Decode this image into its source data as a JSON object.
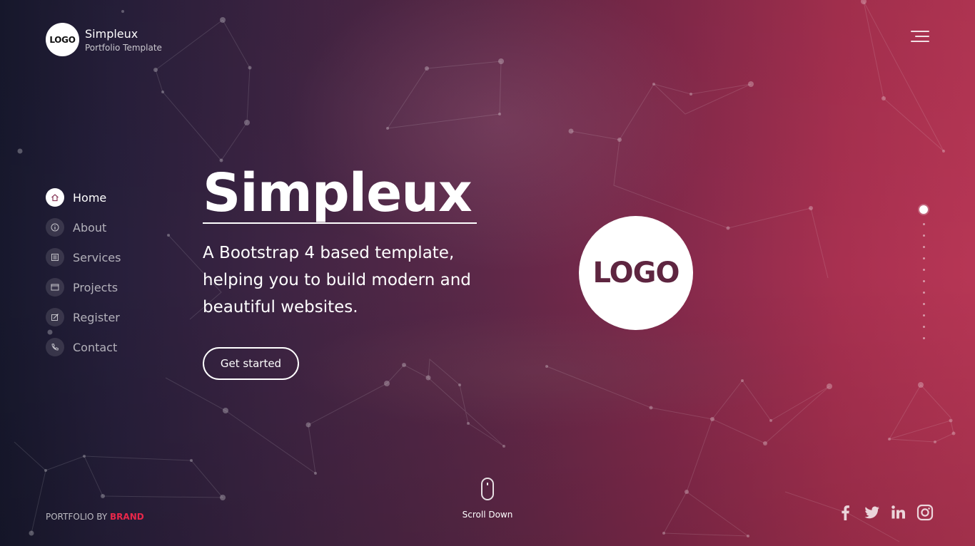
{
  "header": {
    "logo_text": "LOGO",
    "brand_name": "Simpleux",
    "brand_tagline": "Portfolio Template"
  },
  "nav": {
    "items": [
      {
        "label": "Home",
        "icon": "home-icon",
        "active": true
      },
      {
        "label": "About",
        "icon": "info-icon",
        "active": false
      },
      {
        "label": "Services",
        "icon": "list-icon",
        "active": false
      },
      {
        "label": "Projects",
        "icon": "window-icon",
        "active": false
      },
      {
        "label": "Register",
        "icon": "edit-icon",
        "active": false
      },
      {
        "label": "Contact",
        "icon": "phone-icon",
        "active": false
      }
    ]
  },
  "hero": {
    "title": "Simpleux",
    "subtitle": "A Bootstrap 4 based template, helping you to build modern and beautiful websites.",
    "cta_label": "Get started",
    "logo_text": "LOGO"
  },
  "footer": {
    "credit_prefix": "PORTFOLIO BY ",
    "credit_brand": "BRAND",
    "scroll_label": "Scroll Down",
    "social": [
      "facebook-icon",
      "twitter-icon",
      "linkedin-icon",
      "instagram-icon"
    ]
  },
  "colors": {
    "gradient_left": "#17182d",
    "gradient_right": "#b73655",
    "brand_accent": "#e8274a"
  }
}
